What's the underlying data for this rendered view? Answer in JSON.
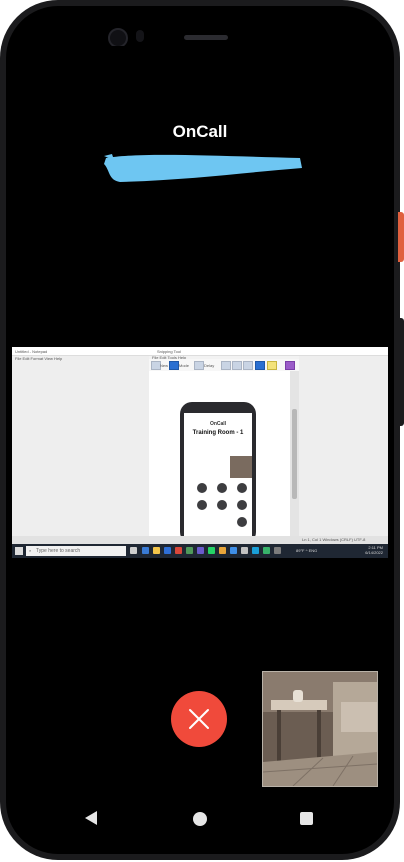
{
  "app": {
    "title": "OnCall"
  },
  "shared_screen": {
    "notepad_title": "Untitled - Notepad",
    "notepad_menu": "File  Edit  Format  View  Help",
    "snipping_title": "Snipping Tool",
    "snipping_menu": "File  Edit  Tools  Help",
    "snipping_new": "New",
    "snipping_mode": "Mode",
    "snipping_delay": "Delay",
    "inner_app_title": "OnCall",
    "inner_room_title": "Training Room - 1",
    "status_text": "Ln 1, Col 1    Windows (CRLF)    UTF-8",
    "taskbar_search_placeholder": "Type here to search",
    "tray_text": "89°F  ^  ENG",
    "clock_time": "2:11 PM",
    "clock_date": "6/14/2022"
  },
  "controls": {
    "end_call_icon": "close-icon",
    "end_call_color": "#f04a3b"
  },
  "nav": {
    "back_icon": "back-triangle-icon",
    "home_icon": "home-circle-icon",
    "recent_icon": "recent-square-icon"
  }
}
